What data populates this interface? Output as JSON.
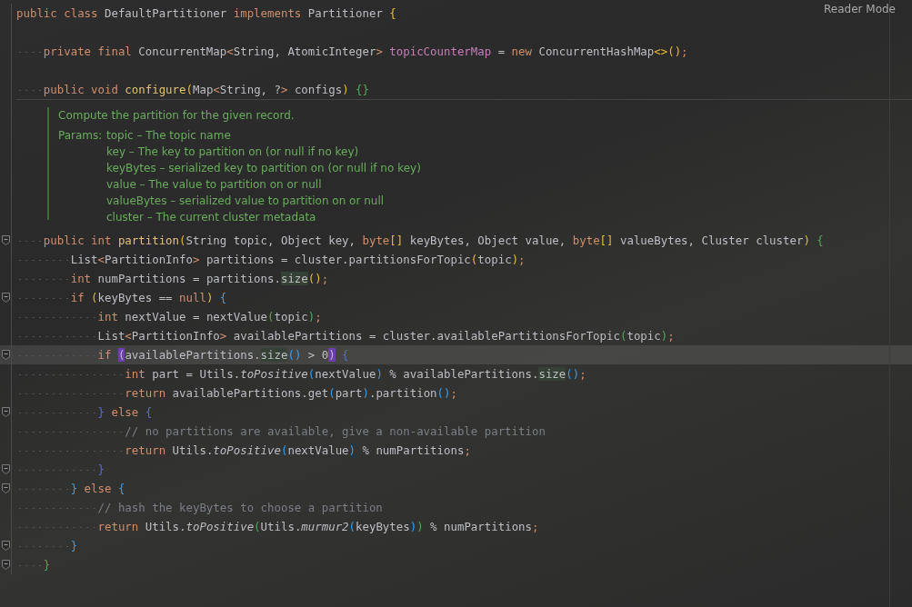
{
  "reader_mode": "Reader Mode",
  "code": [
    {
      "kind": "code",
      "fold": false,
      "current": false,
      "tokens": [
        {
          "kind": "kw",
          "text": "public class"
        },
        {
          "kind": "pl",
          "text": " DefaultPartitioner "
        },
        {
          "kind": "kw",
          "text": "implements"
        },
        {
          "kind": "pl",
          "text": " Partitioner "
        },
        {
          "kind": "b1",
          "text": "{"
        }
      ],
      "children": [
        {
          "kind": "blank",
          "fold": false,
          "current": false
        },
        {
          "kind": "code",
          "fold": false,
          "current": false,
          "tokens": [
            {
              "kind": "kw",
              "text": "private final"
            },
            {
              "kind": "pl",
              "text": " ConcurrentMap"
            },
            {
              "kind": "kw",
              "text": "<"
            },
            {
              "kind": "pl",
              "text": "String, AtomicInteger"
            },
            {
              "kind": "kw",
              "text": ">"
            },
            {
              "kind": "fd",
              "text": " topicCounterMap"
            },
            {
              "kind": "pl",
              "text": " = "
            },
            {
              "kind": "kw",
              "text": "new"
            },
            {
              "kind": "pl",
              "text": " ConcurrentHashMap"
            },
            {
              "kind": "b1",
              "text": "<>"
            },
            {
              "kind": "b1",
              "text": "()"
            },
            {
              "kind": "kw",
              "text": ";"
            }
          ]
        },
        {
          "kind": "blank",
          "fold": false,
          "current": false
        },
        {
          "kind": "code",
          "fold": false,
          "current": false,
          "tokens": [
            {
              "kind": "kw",
              "text": "public void"
            },
            {
              "kind": "fn",
              "text": " configure"
            },
            {
              "kind": "b1",
              "text": "("
            },
            {
              "kind": "pl",
              "text": "Map"
            },
            {
              "kind": "kw",
              "text": "<"
            },
            {
              "kind": "pl",
              "text": "String, ?"
            },
            {
              "kind": "kw",
              "text": ">"
            },
            {
              "kind": "pl",
              "text": " configs"
            },
            {
              "kind": "b1",
              "text": ")"
            },
            {
              "kind": "b2",
              "text": " {}"
            }
          ]
        },
        {
          "kind": "doc",
          "fold": false,
          "current": false,
          "summary": "Compute the partition for the given record.",
          "params_label": "Params:",
          "params": [
            "topic – The topic name",
            "key – The key to partition on (or null if no key)",
            "keyBytes – serialized key to partition on (or null if no key)",
            "value – The value to partition on or null",
            "valueBytes – serialized value to partition on or null",
            "cluster – The current cluster metadata"
          ]
        },
        {
          "kind": "code",
          "fold": true,
          "current": false,
          "tokens": [
            {
              "kind": "kw",
              "text": "public int"
            },
            {
              "kind": "fn",
              "text": " partition"
            },
            {
              "kind": "b1",
              "text": "("
            },
            {
              "kind": "pl",
              "text": "String topic, Object key, "
            },
            {
              "kind": "kw",
              "text": "byte"
            },
            {
              "kind": "b1",
              "text": "[]"
            },
            {
              "kind": "pl",
              "text": " keyBytes, Object value, "
            },
            {
              "kind": "kw",
              "text": "byte"
            },
            {
              "kind": "b1",
              "text": "[]"
            },
            {
              "kind": "pl",
              "text": " valueBytes, Cluster cluster"
            },
            {
              "kind": "b1",
              "text": ")"
            },
            {
              "kind": "b2",
              "text": " {"
            }
          ],
          "children": [
            {
              "kind": "code",
              "fold": false,
              "current": false,
              "tokens": [
                {
                  "kind": "pl",
                  "text": "List"
                },
                {
                  "kind": "kw",
                  "text": "<"
                },
                {
                  "kind": "pl",
                  "text": "PartitionInfo"
                },
                {
                  "kind": "kw",
                  "text": ">"
                },
                {
                  "kind": "pl",
                  "text": " partitions = cluster.partitionsForTopic"
                },
                {
                  "kind": "b1",
                  "text": "("
                },
                {
                  "kind": "pl",
                  "text": "topic"
                },
                {
                  "kind": "b1",
                  "text": ")"
                },
                {
                  "kind": "kw",
                  "text": ";"
                }
              ]
            },
            {
              "kind": "code",
              "fold": false,
              "current": false,
              "tokens": [
                {
                  "kind": "kw",
                  "text": "int"
                },
                {
                  "kind": "pl",
                  "text": " numPartitions = partitions."
                },
                {
                  "kind": "hl",
                  "text": "size"
                },
                {
                  "kind": "b1",
                  "text": "()"
                },
                {
                  "kind": "kw",
                  "text": ";"
                }
              ]
            },
            {
              "kind": "code",
              "fold": true,
              "current": false,
              "tokens": [
                {
                  "kind": "kw",
                  "text": "if"
                },
                {
                  "kind": "b1",
                  "text": " ("
                },
                {
                  "kind": "pl",
                  "text": "keyBytes == "
                },
                {
                  "kind": "kw",
                  "text": "null"
                },
                {
                  "kind": "b1",
                  "text": ")"
                },
                {
                  "kind": "b3",
                  "text": " {"
                }
              ],
              "children": [
                {
                  "kind": "code",
                  "fold": false,
                  "current": false,
                  "tokens": [
                    {
                      "kind": "kw",
                      "text": "int"
                    },
                    {
                      "kind": "pl",
                      "text": " nextValue = nextValue"
                    },
                    {
                      "kind": "b2",
                      "text": "("
                    },
                    {
                      "kind": "pl",
                      "text": "topic"
                    },
                    {
                      "kind": "b2",
                      "text": ")"
                    },
                    {
                      "kind": "kw",
                      "text": ";"
                    }
                  ]
                },
                {
                  "kind": "code",
                  "fold": false,
                  "current": false,
                  "tokens": [
                    {
                      "kind": "pl",
                      "text": "List"
                    },
                    {
                      "kind": "kw",
                      "text": "<"
                    },
                    {
                      "kind": "pl",
                      "text": "PartitionInfo"
                    },
                    {
                      "kind": "kw",
                      "text": ">"
                    },
                    {
                      "kind": "pl",
                      "text": " availablePartitions = cluster.availablePartitionsForTopic"
                    },
                    {
                      "kind": "b2",
                      "text": "("
                    },
                    {
                      "kind": "pl",
                      "text": "topic"
                    },
                    {
                      "kind": "b2",
                      "text": ")"
                    },
                    {
                      "kind": "kw",
                      "text": ";"
                    }
                  ]
                },
                {
                  "kind": "code",
                  "fold": true,
                  "current": true,
                  "tokens": [
                    {
                      "kind": "kw",
                      "text": "if "
                    },
                    {
                      "kind": "hp",
                      "text": "("
                    },
                    {
                      "kind": "pl",
                      "text": "availablePartitions."
                    },
                    {
                      "kind": "hl",
                      "text": "size"
                    },
                    {
                      "kind": "b3",
                      "text": "()"
                    },
                    {
                      "kind": "pl",
                      "text": " > 0"
                    },
                    {
                      "kind": "hp",
                      "text": ")"
                    },
                    {
                      "kind": "b4",
                      "text": " {"
                    }
                  ],
                  "children": [
                    {
                      "kind": "code",
                      "fold": false,
                      "current": false,
                      "tokens": [
                        {
                          "kind": "kw",
                          "text": "int"
                        },
                        {
                          "kind": "pl",
                          "text": " part = Utils."
                        },
                        {
                          "kind": "st",
                          "text": "toPositive"
                        },
                        {
                          "kind": "b3",
                          "text": "("
                        },
                        {
                          "kind": "pl",
                          "text": "nextValue"
                        },
                        {
                          "kind": "b3",
                          "text": ")"
                        },
                        {
                          "kind": "pl",
                          "text": " % availablePartitions."
                        },
                        {
                          "kind": "hl",
                          "text": "size"
                        },
                        {
                          "kind": "b3",
                          "text": "()"
                        },
                        {
                          "kind": "kw",
                          "text": ";"
                        }
                      ]
                    },
                    {
                      "kind": "code",
                      "fold": false,
                      "current": false,
                      "tokens": [
                        {
                          "kind": "kw",
                          "text": "return"
                        },
                        {
                          "kind": "pl",
                          "text": " availablePartitions.get"
                        },
                        {
                          "kind": "b3",
                          "text": "("
                        },
                        {
                          "kind": "pl",
                          "text": "part"
                        },
                        {
                          "kind": "b3",
                          "text": ")"
                        },
                        {
                          "kind": "pl",
                          "text": ".partition"
                        },
                        {
                          "kind": "b3",
                          "text": "()"
                        },
                        {
                          "kind": "kw",
                          "text": ";"
                        }
                      ]
                    }
                  ]
                },
                {
                  "kind": "code",
                  "fold": true,
                  "current": false,
                  "tokens": [
                    {
                      "kind": "b4",
                      "text": "}"
                    },
                    {
                      "kind": "kw",
                      "text": " else"
                    },
                    {
                      "kind": "b4",
                      "text": " {"
                    }
                  ],
                  "children": [
                    {
                      "kind": "code",
                      "fold": false,
                      "current": false,
                      "tokens": [
                        {
                          "kind": "cm",
                          "text": "// no partitions are available, give a non-available partition"
                        }
                      ]
                    },
                    {
                      "kind": "code",
                      "fold": false,
                      "current": false,
                      "tokens": [
                        {
                          "kind": "kw",
                          "text": "return"
                        },
                        {
                          "kind": "pl",
                          "text": " Utils."
                        },
                        {
                          "kind": "st",
                          "text": "toPositive"
                        },
                        {
                          "kind": "b3",
                          "text": "("
                        },
                        {
                          "kind": "pl",
                          "text": "nextValue"
                        },
                        {
                          "kind": "b3",
                          "text": ")"
                        },
                        {
                          "kind": "pl",
                          "text": " % numPartitions"
                        },
                        {
                          "kind": "kw",
                          "text": ";"
                        }
                      ]
                    }
                  ]
                },
                {
                  "kind": "code",
                  "fold": true,
                  "current": false,
                  "tokens": [
                    {
                      "kind": "b4",
                      "text": "}"
                    }
                  ]
                }
              ]
            },
            {
              "kind": "code",
              "fold": true,
              "current": false,
              "tokens": [
                {
                  "kind": "b3",
                  "text": "}"
                },
                {
                  "kind": "kw",
                  "text": " else"
                },
                {
                  "kind": "b3",
                  "text": " {"
                }
              ],
              "children": [
                {
                  "kind": "code",
                  "fold": false,
                  "current": false,
                  "tokens": [
                    {
                      "kind": "cm",
                      "text": "// hash the keyBytes to choose a partition"
                    }
                  ]
                },
                {
                  "kind": "code",
                  "fold": false,
                  "current": false,
                  "tokens": [
                    {
                      "kind": "kw",
                      "text": "return"
                    },
                    {
                      "kind": "pl",
                      "text": " Utils."
                    },
                    {
                      "kind": "st",
                      "text": "toPositive"
                    },
                    {
                      "kind": "b2",
                      "text": "("
                    },
                    {
                      "kind": "pl",
                      "text": "Utils."
                    },
                    {
                      "kind": "st",
                      "text": "murmur2"
                    },
                    {
                      "kind": "b3",
                      "text": "("
                    },
                    {
                      "kind": "pl",
                      "text": "keyBytes"
                    },
                    {
                      "kind": "b3",
                      "text": ")"
                    },
                    {
                      "kind": "b2",
                      "text": ")"
                    },
                    {
                      "kind": "pl",
                      "text": " % numPartitions"
                    },
                    {
                      "kind": "kw",
                      "text": ";"
                    }
                  ]
                }
              ]
            },
            {
              "kind": "code",
              "fold": true,
              "current": false,
              "tokens": [
                {
                  "kind": "b3",
                  "text": "}"
                }
              ]
            }
          ]
        },
        {
          "kind": "code",
          "fold": true,
          "current": false,
          "tokens": [
            {
              "kind": "b2",
              "text": "}"
            }
          ]
        }
      ]
    }
  ]
}
